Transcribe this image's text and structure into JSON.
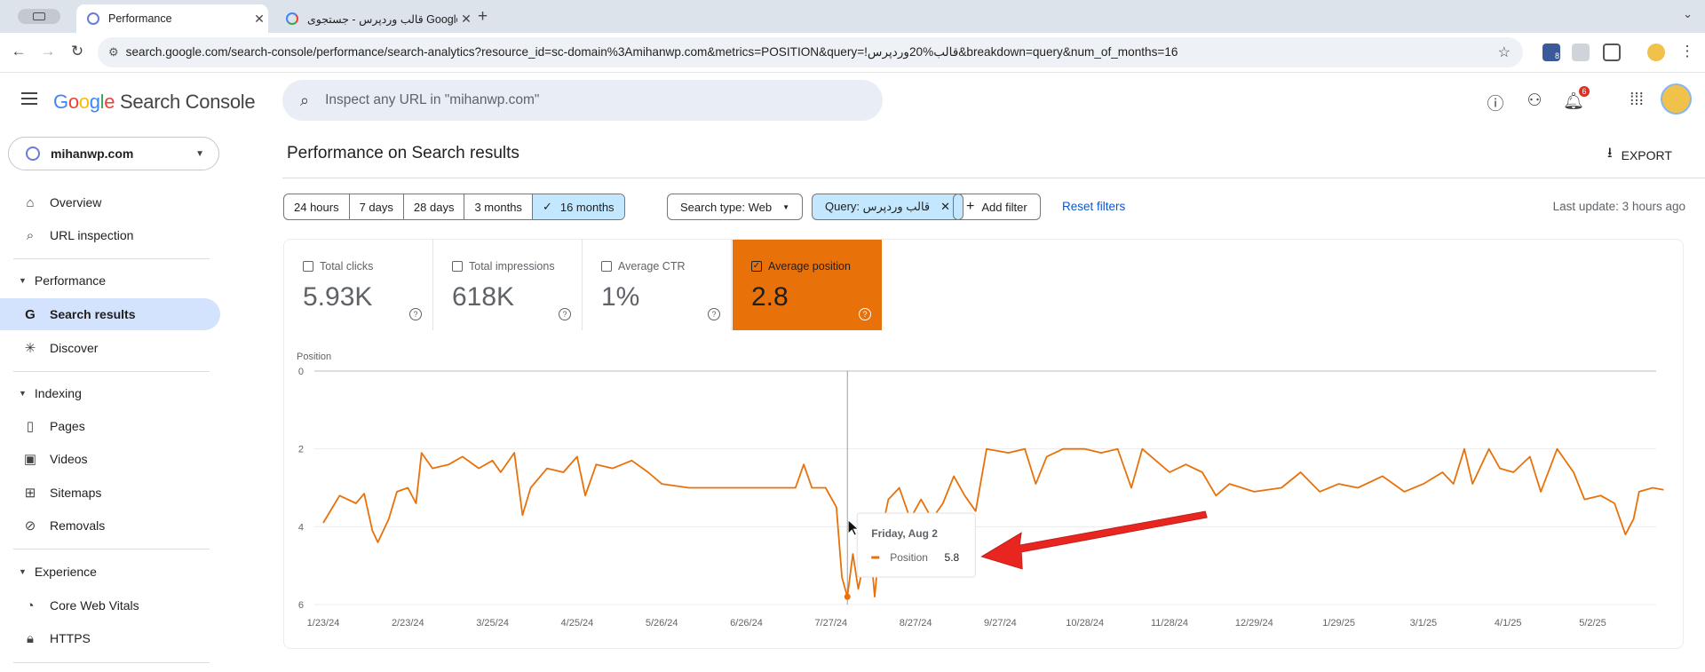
{
  "browser": {
    "tabs": [
      {
        "title": "Performance",
        "active": true
      },
      {
        "title": "قالب وردپرس - جستجوی Google",
        "active": false
      }
    ],
    "url": "search.google.com/search-console/performance/search-analytics?resource_id=sc-domain%3Amihanwp.com&metrics=POSITION&query=!قالب%20وردپرس&breakdown=query&num_of_months=16",
    "ext_badge": "8"
  },
  "header": {
    "logo_letters": [
      "G",
      "o",
      "o",
      "g",
      "l",
      "e"
    ],
    "logo_colors": [
      "#4285f4",
      "#ea4335",
      "#fbbc05",
      "#4285f4",
      "#34a853",
      "#ea4335"
    ],
    "product": "Search Console",
    "search_placeholder": "Inspect any URL in \"mihanwp.com\"",
    "notification_count": "6"
  },
  "sidebar": {
    "property": "mihanwp.com",
    "overview": "Overview",
    "url_inspection": "URL inspection",
    "performance": "Performance",
    "search_results": "Search results",
    "discover": "Discover",
    "indexing": "Indexing",
    "pages": "Pages",
    "videos": "Videos",
    "sitemaps": "Sitemaps",
    "removals": "Removals",
    "experience": "Experience",
    "core_web_vitals": "Core Web Vitals",
    "https": "HTTPS"
  },
  "main": {
    "title": "Performance on Search results",
    "export": "EXPORT",
    "ranges": [
      "24 hours",
      "7 days",
      "28 days",
      "3 months",
      "16 months"
    ],
    "selected_range": "16 months",
    "search_type": "Search type: Web",
    "query_filter": "Query: قالب وردپرس",
    "add_filter": "Add filter",
    "reset_filters": "Reset filters",
    "last_update": "Last update: 3 hours ago"
  },
  "metrics": [
    {
      "label": "Total clicks",
      "value": "5.93K",
      "checked": false
    },
    {
      "label": "Total impressions",
      "value": "618K",
      "checked": false
    },
    {
      "label": "Average CTR",
      "value": "1%",
      "checked": false
    },
    {
      "label": "Average position",
      "value": "2.8",
      "checked": true
    }
  ],
  "colors": {
    "position_line": "#e8710a",
    "tooltip_arrow": "#e8251e"
  },
  "chart_data": {
    "type": "line",
    "ylabel": "Position",
    "y_inverted": true,
    "ylim": [
      0,
      6
    ],
    "y_ticks": [
      "0",
      "2",
      "4",
      "6"
    ],
    "x_ticks": [
      "1/23/24",
      "2/23/24",
      "3/25/24",
      "4/25/24",
      "5/26/24",
      "6/26/24",
      "7/27/24",
      "8/27/24",
      "9/27/24",
      "10/28/24",
      "11/28/24",
      "12/29/24",
      "1/29/25",
      "3/1/25",
      "4/1/25",
      "5/2/25"
    ],
    "series": [
      {
        "name": "Position",
        "color": "#e8710a",
        "points": [
          [
            "2024-01-23",
            3.9
          ],
          [
            "2024-01-29",
            3.2
          ],
          [
            "2024-02-04",
            3.4
          ],
          [
            "2024-02-07",
            3.15
          ],
          [
            "2024-02-10",
            4.1
          ],
          [
            "2024-02-12",
            4.4
          ],
          [
            "2024-02-16",
            3.8
          ],
          [
            "2024-02-19",
            3.1
          ],
          [
            "2024-02-23",
            3.0
          ],
          [
            "2024-02-26",
            3.4
          ],
          [
            "2024-02-28",
            2.1
          ],
          [
            "2024-03-03",
            2.5
          ],
          [
            "2024-03-09",
            2.4
          ],
          [
            "2024-03-14",
            2.2
          ],
          [
            "2024-03-20",
            2.5
          ],
          [
            "2024-03-25",
            2.3
          ],
          [
            "2024-03-28",
            2.6
          ],
          [
            "2024-04-02",
            2.1
          ],
          [
            "2024-04-05",
            3.7
          ],
          [
            "2024-04-08",
            3.0
          ],
          [
            "2024-04-14",
            2.5
          ],
          [
            "2024-04-20",
            2.6
          ],
          [
            "2024-04-25",
            2.2
          ],
          [
            "2024-04-28",
            3.2
          ],
          [
            "2024-05-02",
            2.4
          ],
          [
            "2024-05-08",
            2.5
          ],
          [
            "2024-05-15",
            2.3
          ],
          [
            "2024-05-21",
            2.6
          ],
          [
            "2024-05-26",
            2.9
          ],
          [
            "2024-06-05",
            3.0
          ],
          [
            "2024-06-15",
            3.0
          ],
          [
            "2024-06-26",
            3.0
          ],
          [
            "2024-07-07",
            3.0
          ],
          [
            "2024-07-14",
            3.0
          ],
          [
            "2024-07-17",
            2.4
          ],
          [
            "2024-07-20",
            3.0
          ],
          [
            "2024-07-25",
            3.0
          ],
          [
            "2024-07-29",
            3.5
          ],
          [
            "2024-07-31",
            5.3
          ],
          [
            "2024-08-02",
            5.8
          ],
          [
            "2024-08-04",
            4.7
          ],
          [
            "2024-08-06",
            5.6
          ],
          [
            "2024-08-08",
            4.9
          ],
          [
            "2024-08-10",
            4.2
          ],
          [
            "2024-08-12",
            5.8
          ],
          [
            "2024-08-14",
            4.3
          ],
          [
            "2024-08-17",
            3.3
          ],
          [
            "2024-08-21",
            3.0
          ],
          [
            "2024-08-25",
            3.8
          ],
          [
            "2024-08-29",
            3.3
          ],
          [
            "2024-09-02",
            3.8
          ],
          [
            "2024-09-06",
            3.4
          ],
          [
            "2024-09-10",
            2.7
          ],
          [
            "2024-09-14",
            3.2
          ],
          [
            "2024-09-18",
            3.6
          ],
          [
            "2024-09-22",
            2.0
          ],
          [
            "2024-09-30",
            2.1
          ],
          [
            "2024-10-06",
            2.0
          ],
          [
            "2024-10-10",
            2.9
          ],
          [
            "2024-10-14",
            2.2
          ],
          [
            "2024-10-20",
            2.0
          ],
          [
            "2024-10-28",
            2.0
          ],
          [
            "2024-11-03",
            2.1
          ],
          [
            "2024-11-09",
            2.0
          ],
          [
            "2024-11-14",
            3.0
          ],
          [
            "2024-11-18",
            2.0
          ],
          [
            "2024-11-23",
            2.3
          ],
          [
            "2024-11-28",
            2.6
          ],
          [
            "2024-12-04",
            2.4
          ],
          [
            "2024-12-10",
            2.6
          ],
          [
            "2024-12-15",
            3.2
          ],
          [
            "2024-12-20",
            2.9
          ],
          [
            "2024-12-29",
            3.1
          ],
          [
            "2025-01-08",
            3.0
          ],
          [
            "2025-01-15",
            2.6
          ],
          [
            "2025-01-22",
            3.1
          ],
          [
            "2025-01-29",
            2.9
          ],
          [
            "2025-02-05",
            3.0
          ],
          [
            "2025-02-14",
            2.7
          ],
          [
            "2025-02-22",
            3.1
          ],
          [
            "2025-03-01",
            2.9
          ],
          [
            "2025-03-08",
            2.6
          ],
          [
            "2025-03-12",
            2.9
          ],
          [
            "2025-03-16",
            2.0
          ],
          [
            "2025-03-19",
            2.9
          ],
          [
            "2025-03-25",
            2.0
          ],
          [
            "2025-03-29",
            2.5
          ],
          [
            "2025-04-03",
            2.6
          ],
          [
            "2025-04-09",
            2.2
          ],
          [
            "2025-04-13",
            3.1
          ],
          [
            "2025-04-19",
            2.0
          ],
          [
            "2025-04-25",
            2.6
          ],
          [
            "2025-04-29",
            3.3
          ],
          [
            "2025-05-05",
            3.2
          ],
          [
            "2025-05-10",
            3.4
          ],
          [
            "2025-05-14",
            4.2
          ],
          [
            "2025-05-17",
            3.8
          ],
          [
            "2025-05-19",
            3.1
          ],
          [
            "2025-05-24",
            3.0
          ],
          [
            "2025-05-28",
            3.05
          ]
        ]
      }
    ],
    "tooltip": {
      "date": "Friday, Aug 2",
      "series": "Position",
      "value": "5.8",
      "x": "2024-08-02"
    }
  }
}
